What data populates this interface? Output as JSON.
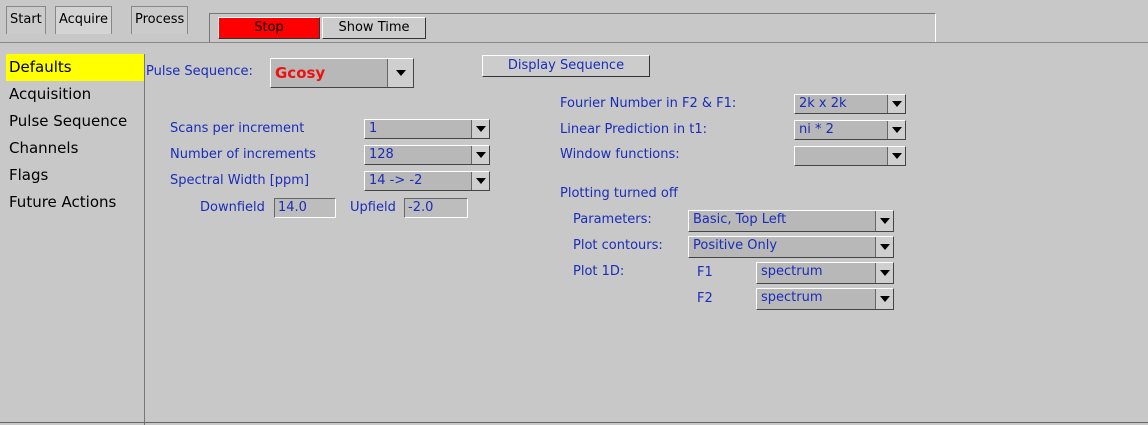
{
  "tabs": [
    {
      "label": "Start"
    },
    {
      "label": "Acquire"
    },
    {
      "label": "Process"
    }
  ],
  "toolbar": {
    "stop_label": "Stop",
    "show_time_label": "Show Time",
    "stop_color": "#ff0000"
  },
  "sidebar": {
    "items": [
      {
        "label": "Defaults",
        "selected": true
      },
      {
        "label": "Acquisition"
      },
      {
        "label": "Pulse Sequence"
      },
      {
        "label": "Channels"
      },
      {
        "label": "Flags"
      },
      {
        "label": "Future Actions"
      }
    ],
    "selected_color": "#ffff00"
  },
  "main": {
    "pulse_sequence_label": "Pulse Sequence:",
    "pulse_sequence_value": "Gcosy",
    "display_sequence_label": "Display Sequence",
    "scans_label": "Scans per increment",
    "scans_value": "1",
    "increments_label": "Number of increments",
    "increments_value": "128",
    "spectral_width_label": "Spectral Width [ppm]",
    "spectral_width_value": "14 -> -2",
    "downfield_label": "Downfield",
    "downfield_value": "14.0",
    "upfield_label": "Upfield",
    "upfield_value": "-2.0",
    "fourier_label": "Fourier Number in F2 & F1:",
    "fourier_value": "2k x 2k",
    "linear_pred_label": "Linear Prediction in t1:",
    "linear_pred_value": "ni * 2",
    "window_label": "Window functions:",
    "window_value": "",
    "plotting_status": "Plotting turned off",
    "parameters_label": "Parameters:",
    "parameters_value": "Basic, Top Left",
    "contours_label": "Plot contours:",
    "contours_value": "Positive Only",
    "plot1d_label": "Plot 1D:",
    "f1_label": "F1",
    "f1_value": "spectrum",
    "f2_label": "F2",
    "f2_value": "spectrum"
  },
  "colors": {
    "text_blue": "#1a2db8",
    "sequence_red": "#ee1111"
  }
}
